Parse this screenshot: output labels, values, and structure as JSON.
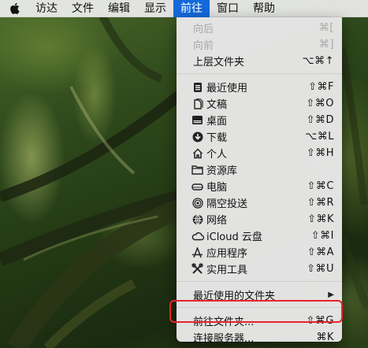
{
  "menubar": {
    "items": [
      {
        "label": "访达"
      },
      {
        "label": "文件"
      },
      {
        "label": "编辑"
      },
      {
        "label": "显示"
      },
      {
        "label": "前往"
      },
      {
        "label": "窗口"
      },
      {
        "label": "帮助"
      }
    ]
  },
  "go_menu": {
    "back": {
      "label": "向后",
      "shortcut": "⌘["
    },
    "forward": {
      "label": "向前",
      "shortcut": "⌘]"
    },
    "enclosing": {
      "label": "上层文件夹",
      "shortcut": "⌥⌘↑"
    },
    "places": [
      {
        "label": "最近使用",
        "shortcut": "⇧⌘F",
        "icon": "recents-icon"
      },
      {
        "label": "文稿",
        "shortcut": "⇧⌘O",
        "icon": "documents-icon"
      },
      {
        "label": "桌面",
        "shortcut": "⇧⌘D",
        "icon": "desktop-icon"
      },
      {
        "label": "下载",
        "shortcut": "⌥⌘L",
        "icon": "downloads-icon"
      },
      {
        "label": "个人",
        "shortcut": "⇧⌘H",
        "icon": "home-icon"
      },
      {
        "label": "资源库",
        "shortcut": "",
        "icon": "library-folder-icon"
      },
      {
        "label": "电脑",
        "shortcut": "⇧⌘C",
        "icon": "computer-icon"
      },
      {
        "label": "隔空投送",
        "shortcut": "⇧⌘R",
        "icon": "airdrop-icon"
      },
      {
        "label": "网络",
        "shortcut": "⇧⌘K",
        "icon": "network-icon"
      },
      {
        "label": "iCloud 云盘",
        "shortcut": "⇧⌘I",
        "icon": "icloud-icon"
      },
      {
        "label": "应用程序",
        "shortcut": "⇧⌘A",
        "icon": "applications-icon"
      },
      {
        "label": "实用工具",
        "shortcut": "⇧⌘U",
        "icon": "utilities-icon"
      }
    ],
    "recent_folders": {
      "label": "最近使用的文件夹",
      "submenu_icon": "submenu-arrow-icon"
    },
    "go_to_folder": {
      "label": "前往文件夹...",
      "shortcut": "⇧⌘G"
    },
    "connect_server": {
      "label": "连接服务器...",
      "shortcut": "⌘K"
    }
  },
  "colors": {
    "menubar_active": "#1469d9",
    "highlight_border": "#e8252a",
    "disabled_text": "#a7a7a7"
  }
}
